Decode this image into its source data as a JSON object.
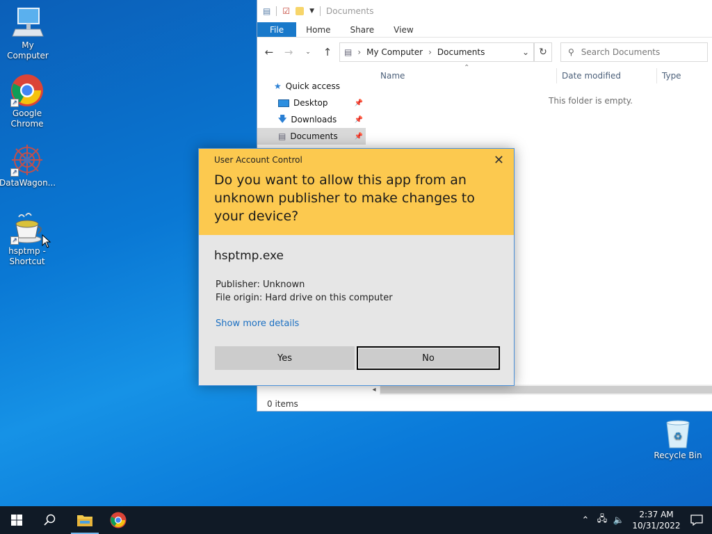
{
  "desktop": {
    "icons": [
      {
        "label": "My Computer"
      },
      {
        "label": "Google Chrome"
      },
      {
        "label": "DataWagon..."
      },
      {
        "label": "hsptmp - Shortcut"
      },
      {
        "label": "Recycle Bin"
      }
    ]
  },
  "explorer": {
    "title": "Documents",
    "tabs": [
      "File",
      "Home",
      "Share",
      "View"
    ],
    "breadcrumb": [
      "My Computer",
      "Documents"
    ],
    "search_placeholder": "Search Documents",
    "nav": [
      {
        "label": "Quick access"
      },
      {
        "label": "Desktop"
      },
      {
        "label": "Downloads"
      },
      {
        "label": "Documents"
      }
    ],
    "columns": [
      "Name",
      "Date modified",
      "Type"
    ],
    "empty_message": "This folder is empty.",
    "status": "0 items"
  },
  "uac": {
    "title": "User Account Control",
    "question": "Do you want to allow this app from an unknown publisher to make changes to your device?",
    "app_name": "hsptmp.exe",
    "publisher": "Publisher: Unknown",
    "origin": "File origin: Hard drive on this computer",
    "details_link": "Show more details",
    "yes_label": "Yes",
    "no_label": "No",
    "header_color": "#fcc94f"
  },
  "taskbar": {
    "time": "2:37 AM",
    "date": "10/31/2022"
  }
}
